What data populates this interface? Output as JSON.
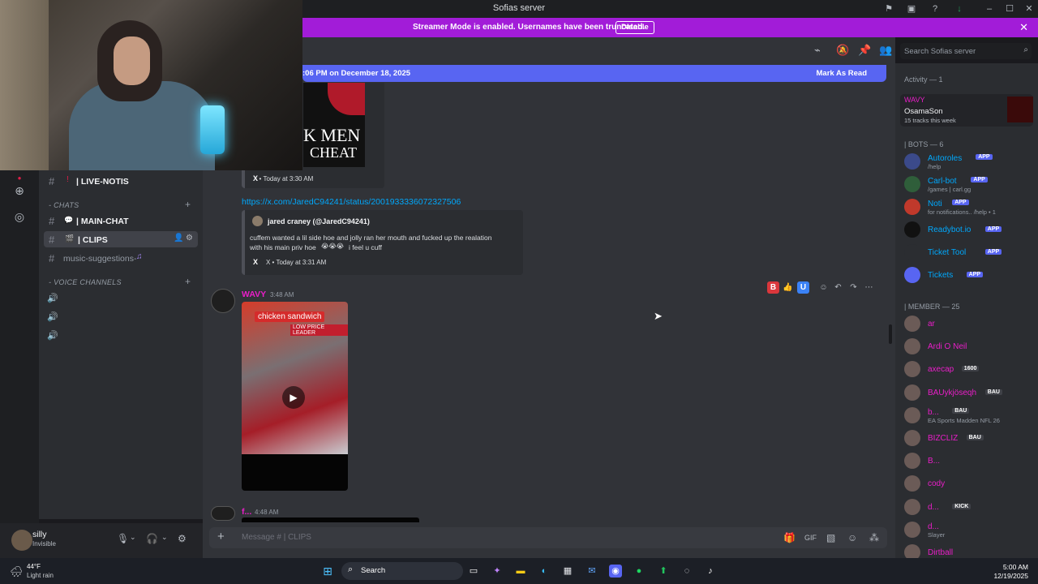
{
  "window": {
    "title": "Sofias server"
  },
  "banner": {
    "text": "Streamer Mode is enabled. Usernames have been truncated.",
    "disable_label": "Disable"
  },
  "new_messages_bar": {
    "text": ":06 PM on December 18, 2025",
    "mark_read_label": "Mark As Read"
  },
  "channels": {
    "items": [
      {
        "label": "| LIVE-NOTIS"
      },
      {
        "label": "| MAIN-CHAT"
      },
      {
        "label": "| CLIPS"
      },
      {
        "label": "music-suggestions-"
      }
    ],
    "categories": [
      {
        "label": "- CHATS"
      },
      {
        "label": "- VOICE CHANNELS"
      }
    ]
  },
  "user_panel": {
    "name": "silly",
    "status": "Invisible"
  },
  "messages": {
    "embed1": {
      "image_text_1": "K MEN",
      "image_text_2": "CHEAT",
      "source": "X • Today at 3:30 AM"
    },
    "link": "https://x.com/JaredC94241/status/2001933336072327506",
    "embed2": {
      "author": "jared craney (@JaredC94241)",
      "body_line1": "cuffem wanted a lil side hoe and jolly ran her mouth and fucked up the realation",
      "body_line2": "with his main priv hoe",
      "body_line2b": " i feel u cuff",
      "source": "X • Today at 3:31 AM"
    },
    "msg1": {
      "author": "WAVY",
      "time": "3:48 AM",
      "video_caption": "chicken sandwich",
      "video_sign": "LOW PRICE LEADER"
    },
    "msg2": {
      "author": "f...",
      "time": "4:48 AM"
    }
  },
  "composer": {
    "placeholder": "Message #  | CLIPS"
  },
  "search": {
    "placeholder": "Search Sofias server"
  },
  "members": {
    "activity_header": "Activity — 1",
    "activity": {
      "name": "WAVY",
      "game": "OsamaSon",
      "detail": "15 tracks this week"
    },
    "bots_header": "| BOTS — 6",
    "bots": [
      {
        "name": "Autoroles",
        "tag": "APP",
        "sub": "/help"
      },
      {
        "name": "Carl-bot",
        "tag": "APP",
        "sub": "/games | carl.gg"
      },
      {
        "name": "Noti",
        "tag": "APP",
        "sub": "for notifications.. /help • 1"
      },
      {
        "name": "Readybot.io",
        "tag": "APP",
        "sub": ""
      },
      {
        "name": "Ticket Tool",
        "tag": "APP",
        "sub": ""
      },
      {
        "name": "Tickets",
        "tag": "APP",
        "sub": ""
      }
    ],
    "member_header": "| MEMBER — 25",
    "members": [
      {
        "name": "ar",
        "tag": "",
        "sub": ""
      },
      {
        "name": "Ardi O Neil",
        "tag": "",
        "sub": ""
      },
      {
        "name": "axecap",
        "tag": "1600",
        "sub": ""
      },
      {
        "name": "BAUykjöseqh",
        "tag": "BAU",
        "sub": ""
      },
      {
        "name": "b...",
        "tag": "BAU",
        "sub": "EA Sports Madden NFL 26"
      },
      {
        "name": "BIZCLIZ",
        "tag": "BAU",
        "sub": ""
      },
      {
        "name": "B...",
        "tag": "",
        "sub": ""
      },
      {
        "name": "cody",
        "tag": "",
        "sub": ""
      },
      {
        "name": "d...",
        "tag": "KICK",
        "sub": ""
      },
      {
        "name": "d...",
        "tag": "",
        "sub": "Slayer"
      },
      {
        "name": "Dirtball",
        "tag": "",
        "sub": ""
      }
    ]
  },
  "taskbar": {
    "temp": "44°F",
    "weather": "Light rain",
    "search_label": "Search",
    "time": "5:00 AM",
    "date": "12/19/2025"
  },
  "colors": {
    "banner": "#a21cd8",
    "blurple": "#5865f2",
    "member_name": "#e91ec8",
    "bot_name": "#00a8fc"
  }
}
